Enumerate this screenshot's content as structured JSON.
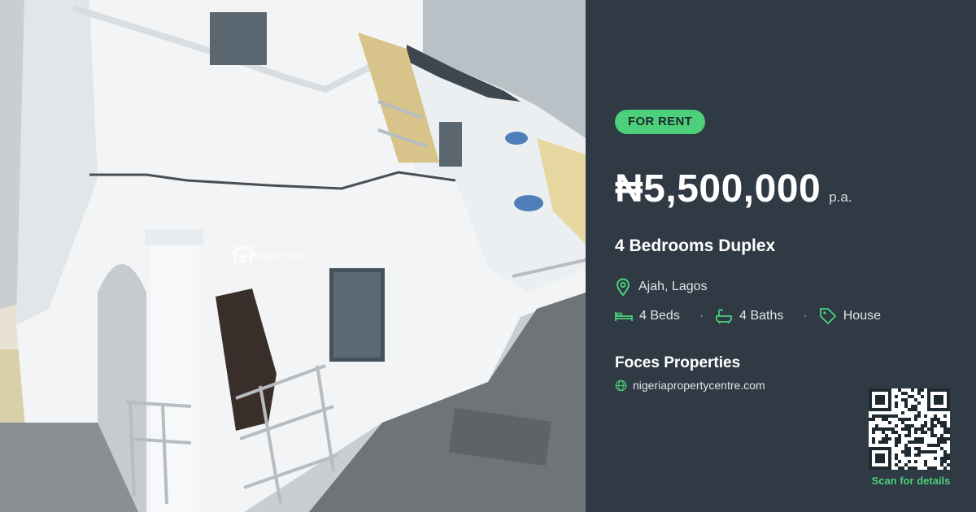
{
  "photo": {
    "alt": "Property photo",
    "watermark_top": "Nigeria",
    "watermark_bottom": "propertycentre"
  },
  "listing": {
    "status": "FOR RENT",
    "price": "₦5,500,000",
    "period": "p.a.",
    "title": "4 Bedrooms Duplex",
    "location": "Ajah, Lagos",
    "beds": "4 Beds",
    "baths": "4 Baths",
    "type": "House",
    "separator": "·"
  },
  "agent": {
    "name": "Foces Properties",
    "website": "nigeriapropertycentre.com"
  },
  "qr": {
    "cta": "Scan for details"
  },
  "colors": {
    "panel_bg": "#2f3a44",
    "accent": "#4cd07a",
    "text": "#ffffff"
  },
  "icons": [
    "location-pin-icon",
    "bed-icon",
    "bath-icon",
    "tag-icon",
    "globe-icon",
    "house-logo-icon"
  ]
}
